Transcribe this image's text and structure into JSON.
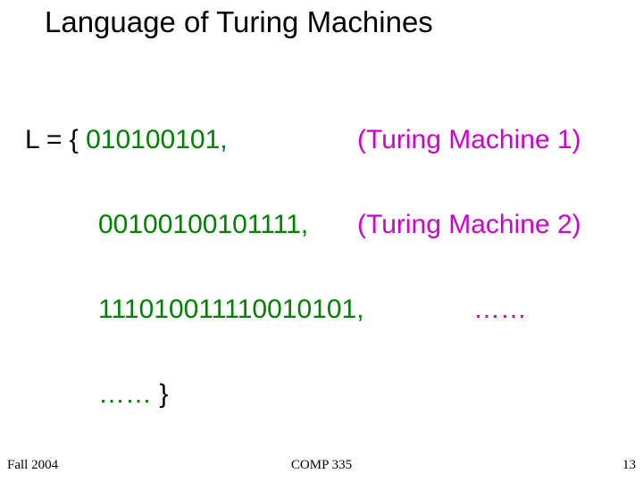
{
  "title": "Language of Turing Machines",
  "lines": {
    "l1_prefix": "L = { ",
    "l1_code": "010100101,",
    "l1_note": "(Turing Machine 1)",
    "l2_code": "00100100101111,",
    "l2_note": "(Turing Machine 2)",
    "l3_code": "111010011110010101,",
    "l3_note": "……",
    "l4_code": "…… }"
  },
  "footer": {
    "left": "Fall 2004",
    "center": "COMP 335",
    "right": "13"
  }
}
